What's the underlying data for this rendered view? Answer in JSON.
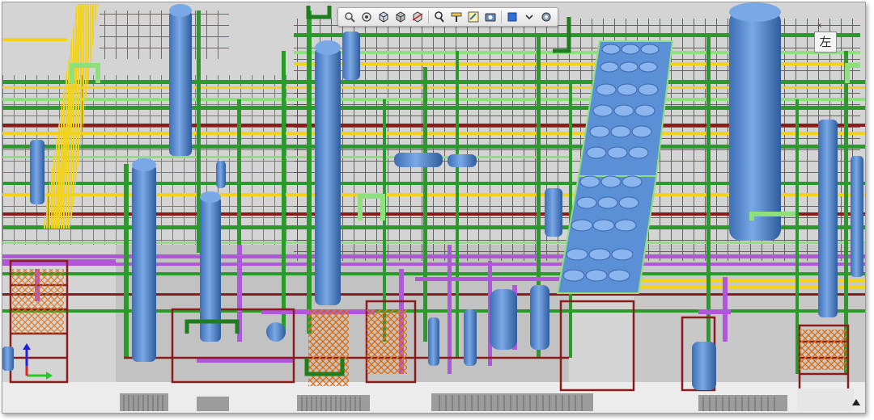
{
  "app": {
    "viewcube_label": "左",
    "viewcube_axis": "x"
  },
  "toolbar": {
    "tools": [
      {
        "name": "zoom-icon"
      },
      {
        "name": "zoom-extents-icon"
      },
      {
        "name": "cube-select-icon"
      },
      {
        "name": "cube-hide-icon"
      },
      {
        "name": "cube-section-icon"
      },
      {
        "name": "find-icon"
      },
      {
        "name": "measure-icon"
      },
      {
        "name": "markup-icon"
      },
      {
        "name": "snapshot-icon"
      },
      {
        "name": "color-picker-icon"
      },
      {
        "name": "dropdown-chevron-icon"
      },
      {
        "name": "settings-icon"
      }
    ]
  },
  "scene": {
    "colors": {
      "ground": "#d6d6d6",
      "slab": "#bcbcbc",
      "steel": "#8b1c1c",
      "pipe_green": "#2a9a2a",
      "pipe_lightgreen": "#8de07c",
      "pipe_yellow": "#f2d21a",
      "pipe_purple": "#b056d8",
      "vessel_blue": "#5b8fd6",
      "grating_orange": "#e07a22"
    }
  },
  "triad": {
    "colors": {
      "x": "#22cc22",
      "y": "#2222dd",
      "z": "#dd2222"
    }
  }
}
